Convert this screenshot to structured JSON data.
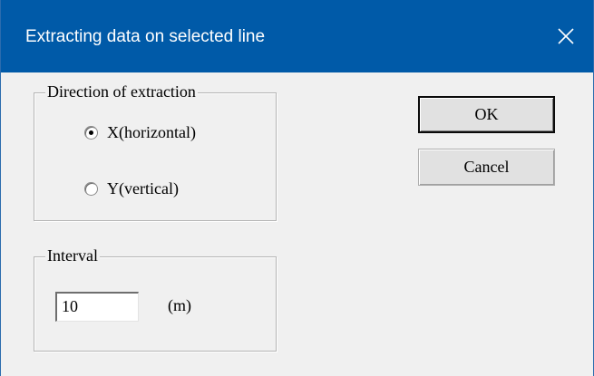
{
  "window": {
    "title": "Extracting data on selected line",
    "close_glyph": "close-icon"
  },
  "direction_group": {
    "label": "Direction of extraction",
    "options": [
      {
        "label": "X(horizontal)",
        "selected": true
      },
      {
        "label": "Y(vertical)",
        "selected": false
      }
    ]
  },
  "interval_group": {
    "label": "Interval",
    "value": "10",
    "unit": "(m)"
  },
  "buttons": {
    "ok_label": "OK",
    "cancel_label": "Cancel"
  },
  "colors": {
    "titlebar": "#005aa8",
    "dialog_bg": "#f0f0f0"
  }
}
